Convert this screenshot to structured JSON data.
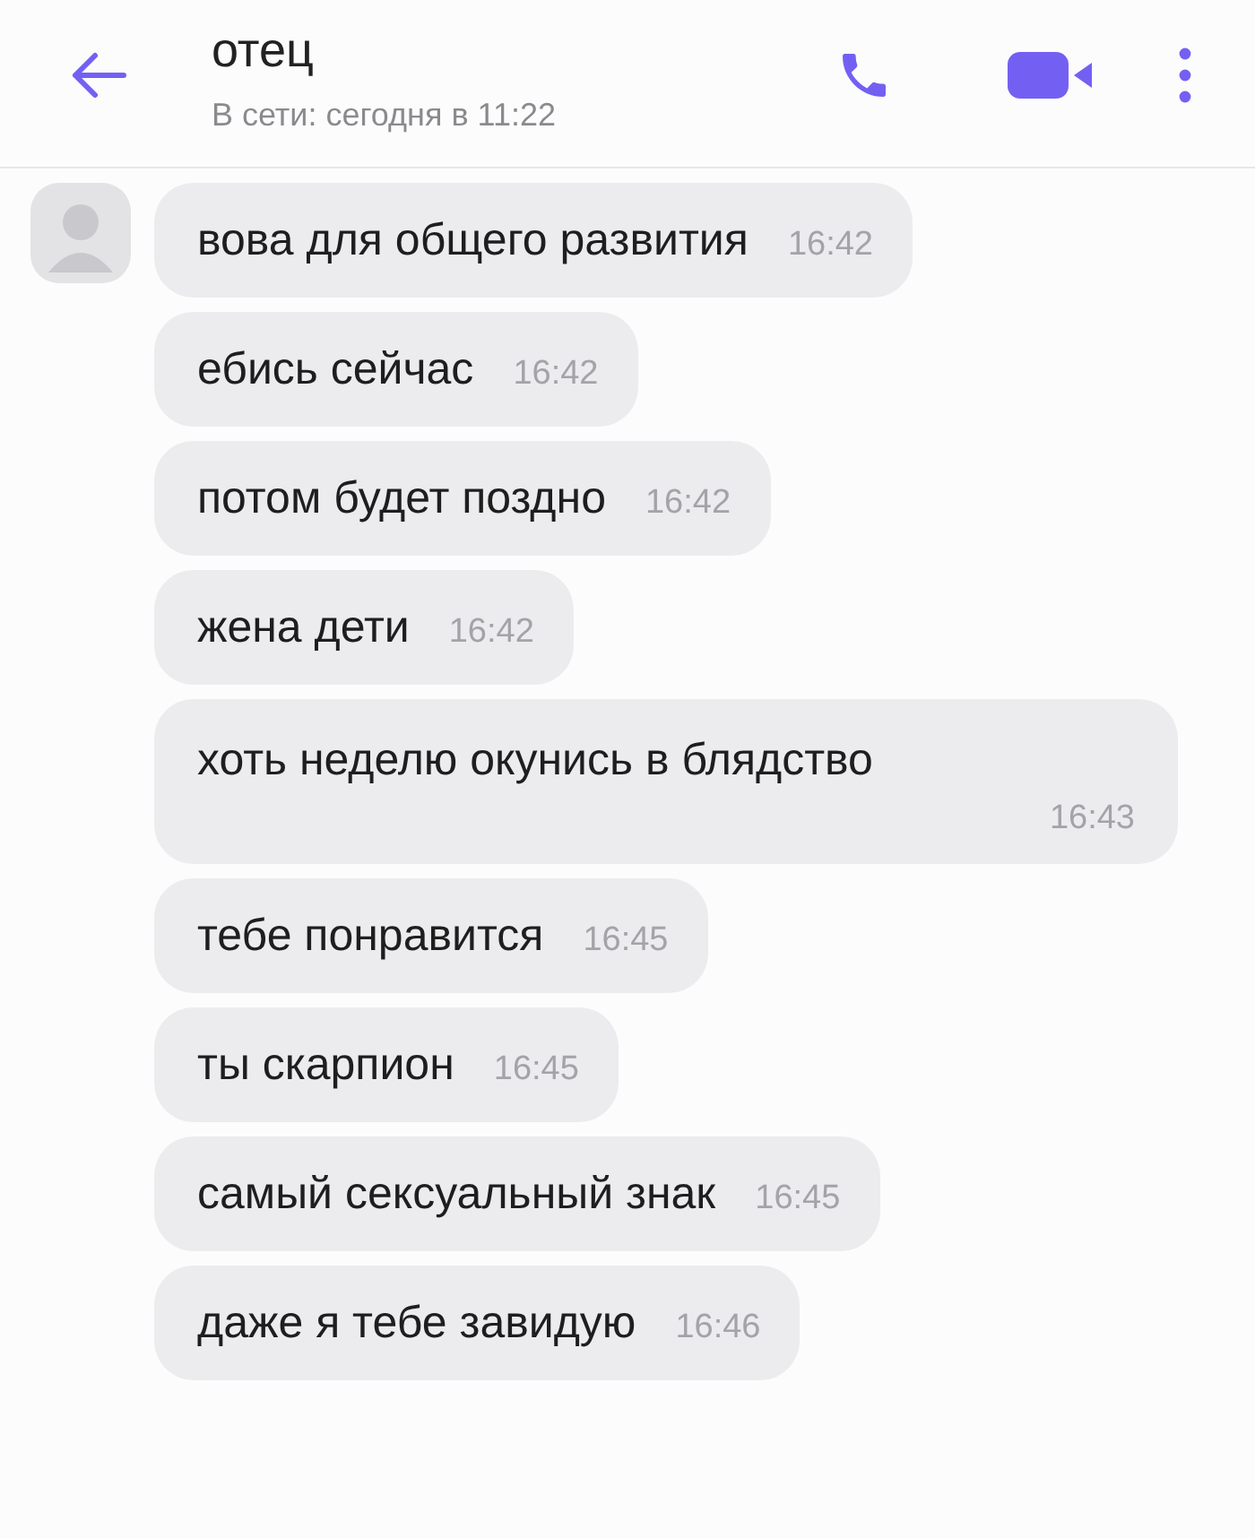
{
  "header": {
    "title": "отец",
    "status": "В сети: сегодня в 11:22"
  },
  "messages": [
    {
      "text": "вова для общего развития",
      "time": "16:42",
      "kind": "inline"
    },
    {
      "text": "ебись сейчас",
      "time": "16:42",
      "kind": "inline"
    },
    {
      "text": "потом будет поздно",
      "time": "16:42",
      "kind": "inline"
    },
    {
      "text": "жена дети",
      "time": "16:42",
      "kind": "inline"
    },
    {
      "text": "хоть неделю окунись в блядство",
      "time": "16:43",
      "kind": "block"
    },
    {
      "text": "тебе понравится",
      "time": "16:45",
      "kind": "inline"
    },
    {
      "text": "ты скарпион",
      "time": "16:45",
      "kind": "inline"
    },
    {
      "text": "самый сексуальный знак",
      "time": "16:45",
      "kind": "inline"
    },
    {
      "text": "даже я тебе завидую",
      "time": "16:46",
      "kind": "inline"
    }
  ]
}
